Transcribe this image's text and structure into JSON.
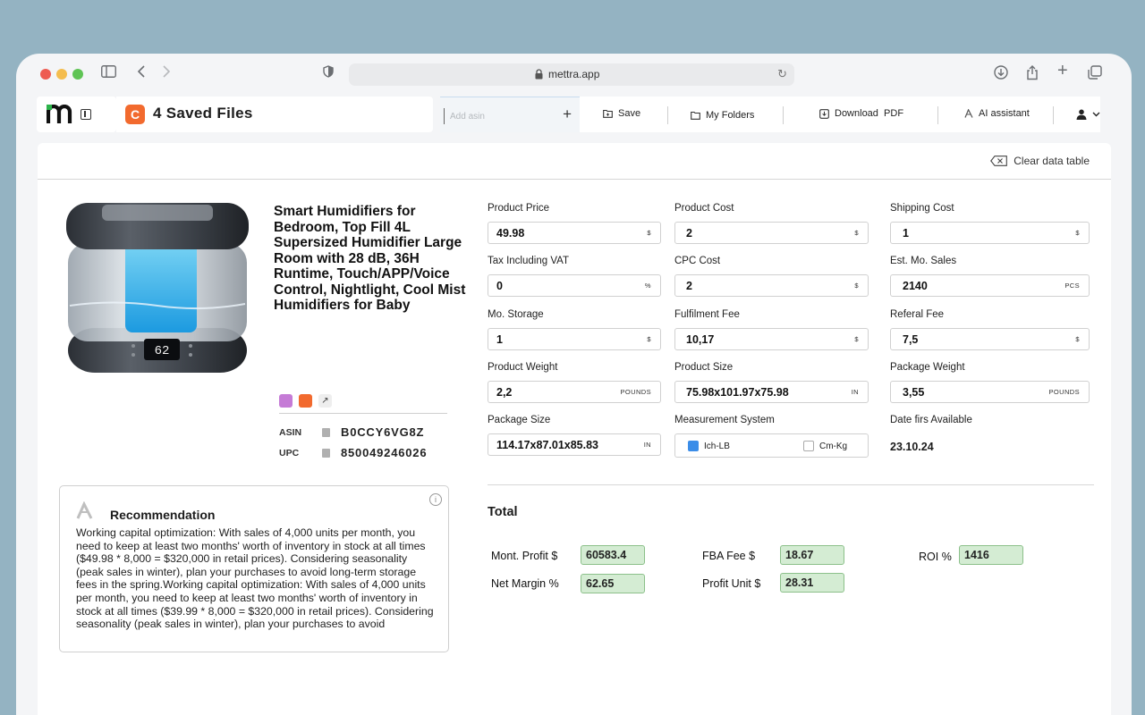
{
  "browser": {
    "url": "mettra.app"
  },
  "header": {
    "files_title": "4 Saved Files",
    "files_icon_letter": "C",
    "asin_placeholder": "Add asin",
    "toolbar": {
      "save": "Save",
      "folders": "My Folders",
      "download": "Download  PDF",
      "ai": "AI assistant"
    }
  },
  "panel": {
    "clear_label": "Clear data table"
  },
  "product": {
    "title": "Smart Humidifiers for Bedroom, Top Fill 4L Supersized Humidifier Large Room with 28 dB, 36H Runtime, Touch/APP/Voice Control, Nightlight, Cool Mist Humidifiers for Baby",
    "display_reading": "62",
    "asin_label": "ASIN",
    "asin": "B0CCY6VG8Z",
    "upc_label": "UPC",
    "upc": "850049246026"
  },
  "recommendation": {
    "title": "Recommendation",
    "body": "Working capital optimization: With sales of 4,000 units per month, you need to keep at least two months' worth of inventory in stock at all times ($49.98 * 8,000 = $320,000 in retail prices). Considering seasonality (peak sales in winter), plan your purchases to avoid long-term storage fees in the spring.Working capital optimization: With sales of 4,000 units per month, you need to keep at least two months' worth of inventory in stock at all times ($39.99 * 8,000 = $320,000 in retail prices). Considering seasonality (peak sales in winter), plan your purchases to avoid"
  },
  "fields": {
    "product_price": {
      "label": "Product Price",
      "value": "49.98",
      "unit": "$"
    },
    "product_cost": {
      "label": "Product Cost",
      "value": "2",
      "unit": "$"
    },
    "shipping_cost": {
      "label": "Shipping Cost",
      "value": "1",
      "unit": "$"
    },
    "tax_vat": {
      "label": "Tax Including VAT",
      "value": "0",
      "unit": "%"
    },
    "cpc_cost": {
      "label": "CPC Cost",
      "value": "2",
      "unit": "$"
    },
    "est_sales": {
      "label": "Est. Mo. Sales",
      "value": "2140",
      "unit": "PCS"
    },
    "mo_storage": {
      "label": "Mo. Storage",
      "value": "1",
      "unit": "$"
    },
    "fulfilment_fee": {
      "label": "Fulfilment Fee",
      "value": "10,17",
      "unit": "$"
    },
    "referal_fee": {
      "label": "Referal Fee",
      "value": "7,5",
      "unit": "$"
    },
    "product_weight": {
      "label": "Product Weight",
      "value": "2,2",
      "unit": "POUNDS"
    },
    "product_size": {
      "label": "Product Size",
      "value": "75.98x101.97x75.98",
      "unit": "IN"
    },
    "package_weight": {
      "label": "Package Weight",
      "value": "3,55",
      "unit": "POUNDS"
    },
    "package_size": {
      "label": "Package Size",
      "value": "114.17x87.01x85.83",
      "unit": "IN"
    },
    "measurement": {
      "label": "Measurement System",
      "option_a": "Ich-LB",
      "option_b": "Cm-Kg",
      "selected": "Ich-LB"
    },
    "date_first": {
      "label": "Date firs Available",
      "value": "23.10.24"
    }
  },
  "totals": {
    "title": "Total",
    "month_profit": {
      "label": "Mont. Profit $",
      "value": "60583.4"
    },
    "fba_fee": {
      "label": "FBA Fee $",
      "value": "18.67"
    },
    "roi": {
      "label": "ROI %",
      "value": "1416"
    },
    "net_margin": {
      "label": "Net Margin %",
      "value": "62.65"
    },
    "profit_unit": {
      "label": "Profit Unit $",
      "value": "28.31"
    }
  },
  "colors": {
    "accent_orange": "#f26a2e",
    "accent_purple": "#c57bd6",
    "result_bg": "#d4ecd3",
    "checkbox_blue": "#3b8de8"
  }
}
